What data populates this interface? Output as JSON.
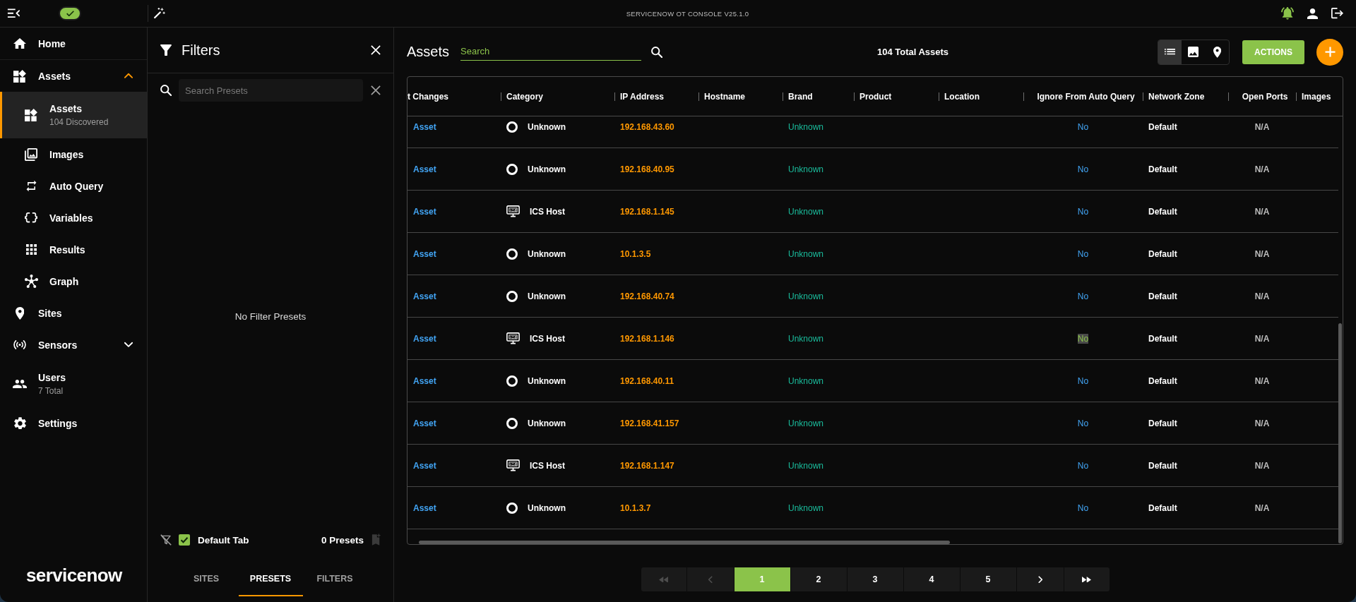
{
  "top_bar": {
    "status_toggle": {
      "on": true
    },
    "title": "SERVICENOW OT CONSOLE V25.1.0"
  },
  "sidebar": {
    "items": [
      {
        "label": "Home",
        "selected": false
      },
      {
        "label": "Assets",
        "selected": false,
        "expanded": true,
        "children": [
          {
            "label": "Assets",
            "subtitle": "104 Discovered",
            "selected": true
          },
          {
            "label": "Images",
            "selected": false
          },
          {
            "label": "Auto Query",
            "selected": false
          },
          {
            "label": "Variables",
            "selected": false
          },
          {
            "label": "Results",
            "selected": false
          },
          {
            "label": "Graph",
            "selected": false
          }
        ]
      },
      {
        "label": "Sites",
        "selected": false
      },
      {
        "label": "Sensors",
        "selected": false,
        "expanded": false
      },
      {
        "label": "Users",
        "subtitle": "7 Total",
        "selected": false
      },
      {
        "label": "Settings",
        "selected": false
      }
    ],
    "logo": "servicenow"
  },
  "filters_panel": {
    "title": "Filters",
    "search": {
      "placeholder": "Search Presets"
    },
    "empty_message": "No Filter Presets",
    "default_tab": {
      "label": "Default Tab",
      "checked": true
    },
    "presets_count": "0 Presets",
    "tabs": [
      {
        "label": "SITES",
        "selected": false
      },
      {
        "label": "PRESETS",
        "selected": true
      },
      {
        "label": "FILTERS",
        "selected": false
      }
    ]
  },
  "assets_view": {
    "title": "Assets",
    "search": {
      "placeholder": "Search"
    },
    "total": "104 Total Assets",
    "view_modes": [
      {
        "selected": true
      },
      {
        "selected": false
      },
      {
        "selected": false
      }
    ],
    "actions_button": "ACTIONS",
    "table": {
      "columns": [
        "t Changes",
        "Category",
        "IP Address",
        "Hostname",
        "Brand",
        "Product",
        "Location",
        "Ignore From Auto Query",
        "Network Zone",
        "Open Ports",
        "Images"
      ],
      "rows": [
        {
          "action": "Asset",
          "category": "Unknown",
          "kind": "unknown",
          "ip_address": "192.168.43.60",
          "brand": "Unknown",
          "ignore_from_auto_query": "No",
          "highlighted": false,
          "network_zone": "Default",
          "open_ports": "N/A"
        },
        {
          "action": "Asset",
          "category": "Unknown",
          "kind": "unknown",
          "ip_address": "192.168.40.95",
          "brand": "Unknown",
          "ignore_from_auto_query": "No",
          "highlighted": false,
          "network_zone": "Default",
          "open_ports": "N/A"
        },
        {
          "action": "Asset",
          "category": "ICS Host",
          "kind": "ics_host",
          "ip_address": "192.168.1.145",
          "brand": "Unknown",
          "ignore_from_auto_query": "No",
          "highlighted": false,
          "network_zone": "Default",
          "open_ports": "N/A"
        },
        {
          "action": "Asset",
          "category": "Unknown",
          "kind": "unknown",
          "ip_address": "10.1.3.5",
          "brand": "Unknown",
          "ignore_from_auto_query": "No",
          "highlighted": false,
          "network_zone": "Default",
          "open_ports": "N/A"
        },
        {
          "action": "Asset",
          "category": "Unknown",
          "kind": "unknown",
          "ip_address": "192.168.40.74",
          "brand": "Unknown",
          "ignore_from_auto_query": "No",
          "highlighted": false,
          "network_zone": "Default",
          "open_ports": "N/A"
        },
        {
          "action": "Asset",
          "category": "ICS Host",
          "kind": "ics_host",
          "ip_address": "192.168.1.146",
          "brand": "Unknown",
          "ignore_from_auto_query": "No",
          "highlighted": true,
          "network_zone": "Default",
          "open_ports": "N/A"
        },
        {
          "action": "Asset",
          "category": "Unknown",
          "kind": "unknown",
          "ip_address": "192.168.40.11",
          "brand": "Unknown",
          "ignore_from_auto_query": "No",
          "highlighted": false,
          "network_zone": "Default",
          "open_ports": "N/A"
        },
        {
          "action": "Asset",
          "category": "Unknown",
          "kind": "unknown",
          "ip_address": "192.168.41.157",
          "brand": "Unknown",
          "ignore_from_auto_query": "No",
          "highlighted": false,
          "network_zone": "Default",
          "open_ports": "N/A"
        },
        {
          "action": "Asset",
          "category": "ICS Host",
          "kind": "ics_host",
          "ip_address": "192.168.1.147",
          "brand": "Unknown",
          "ignore_from_auto_query": "No",
          "highlighted": false,
          "network_zone": "Default",
          "open_ports": "N/A"
        },
        {
          "action": "Asset",
          "category": "Unknown",
          "kind": "unknown",
          "ip_address": "10.1.3.7",
          "brand": "Unknown",
          "ignore_from_auto_query": "No",
          "highlighted": false,
          "network_zone": "Default",
          "open_ports": "N/A"
        }
      ]
    }
  },
  "pagination": {
    "first": {
      "disabled": true
    },
    "previous": {
      "disabled": true
    },
    "pages": [
      {
        "label": "1",
        "selected": true
      },
      {
        "label": "2",
        "selected": false
      },
      {
        "label": "3",
        "selected": false
      },
      {
        "label": "4",
        "selected": false
      },
      {
        "label": "5",
        "selected": false
      }
    ],
    "next": {
      "disabled": false
    },
    "last": {
      "disabled": false
    }
  }
}
